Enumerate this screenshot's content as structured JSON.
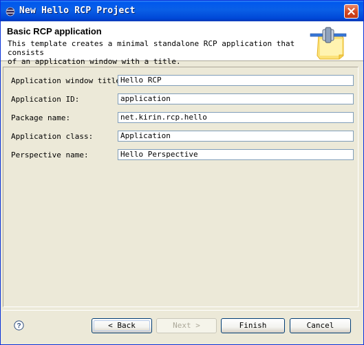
{
  "window": {
    "title": "New Hello RCP Project"
  },
  "header": {
    "title": "Basic RCP application",
    "description": "This template creates a minimal standalone RCP application that consists\nof an application window with a title."
  },
  "form": {
    "fields": [
      {
        "label": "Application window title:",
        "value": "Hello RCP"
      },
      {
        "label": "Application ID:",
        "value": "application"
      },
      {
        "label": "Package name:",
        "value": "net.kirin.rcp.hello"
      },
      {
        "label": "Application class:",
        "value": "Application"
      },
      {
        "label": "Perspective name:",
        "value": "Hello Perspective"
      }
    ]
  },
  "buttons": {
    "back": "< Back",
    "next": "Next >",
    "finish": "Finish",
    "cancel": "Cancel"
  },
  "icons": {
    "title": "eclipse-icon",
    "close": "close-icon",
    "wizard": "plugin-wizard-icon",
    "help": "help-icon"
  }
}
